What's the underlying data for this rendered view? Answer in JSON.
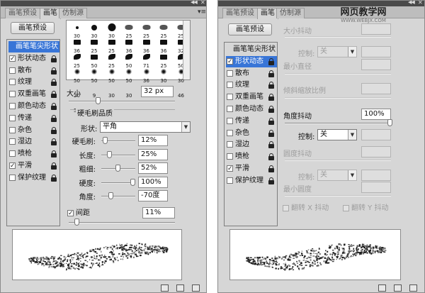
{
  "watermark": {
    "main": "网页教学网",
    "sub": "WWW.WEBJX.COM"
  },
  "left": {
    "tabs": [
      {
        "label": "画笔预设",
        "active": false
      },
      {
        "label": "画笔",
        "active": true
      },
      {
        "label": "仿制源",
        "active": false
      }
    ],
    "preset_button": "画笔预设",
    "options": [
      {
        "label": "画笔笔尖形状",
        "header": true,
        "selected": true,
        "checked": false
      },
      {
        "label": "形状动态",
        "checked": true,
        "lock": true
      },
      {
        "label": "散布",
        "checked": false,
        "lock": true
      },
      {
        "label": "纹理",
        "checked": false,
        "lock": true
      },
      {
        "label": "双重画笔",
        "checked": false,
        "lock": true
      },
      {
        "label": "颜色动态",
        "checked": false,
        "lock": true
      },
      {
        "label": "传递",
        "checked": false,
        "lock": true
      },
      {
        "label": "杂色",
        "checked": false,
        "lock": true
      },
      {
        "label": "湿边",
        "checked": false,
        "lock": true
      },
      {
        "label": "喷枪",
        "checked": false,
        "lock": true
      },
      {
        "label": "平滑",
        "checked": true,
        "lock": true
      },
      {
        "label": "保护纹理",
        "checked": false,
        "lock": true
      }
    ],
    "brush_sizes": [
      "30",
      "30",
      "30",
      "25",
      "25",
      "25",
      "25",
      "36",
      "25",
      "25",
      "36",
      "36",
      "36",
      "32",
      "25",
      "50",
      "25",
      "50",
      "71",
      "25",
      "50",
      "50",
      "50",
      "50",
      "50",
      "36",
      "30",
      "30",
      "20",
      "9",
      "30",
      "30",
      "27",
      "39",
      "46",
      "59"
    ],
    "size": {
      "label": "大小",
      "value": "32 px",
      "level": 0.05
    },
    "bristle": {
      "title": "硬毛刷品质",
      "shape_label": "形状:",
      "shape_value": "平角",
      "rows": [
        {
          "label": "硬毛刷:",
          "value": "12%",
          "level": 0.12
        },
        {
          "label": "长度:",
          "value": "25%",
          "level": 0.25
        },
        {
          "label": "粗细:",
          "value": "52%",
          "level": 0.52
        },
        {
          "label": "硬度:",
          "value": "100%",
          "level": 1.0
        },
        {
          "label": "角度:",
          "value": "-70度",
          "level": 0.3
        }
      ]
    },
    "spacing": {
      "label": "间距",
      "checked": true,
      "value": "11%",
      "level": 0.05
    }
  },
  "right": {
    "tabs": [
      {
        "label": "画笔预设",
        "active": false
      },
      {
        "label": "画笔",
        "active": true
      },
      {
        "label": "仿制源",
        "active": false
      }
    ],
    "preset_button": "画笔预设",
    "options": [
      {
        "label": "画笔笔尖形状",
        "header": true,
        "selected": false,
        "checked": false
      },
      {
        "label": "形状动态",
        "checked": true,
        "lock": true,
        "selected": true
      },
      {
        "label": "散布",
        "checked": false,
        "lock": true
      },
      {
        "label": "纹理",
        "checked": false,
        "lock": true
      },
      {
        "label": "双重画笔",
        "checked": false,
        "lock": true
      },
      {
        "label": "颜色动态",
        "checked": false,
        "lock": true
      },
      {
        "label": "传递",
        "checked": false,
        "lock": true
      },
      {
        "label": "杂色",
        "checked": false,
        "lock": true
      },
      {
        "label": "湿边",
        "checked": false,
        "lock": true
      },
      {
        "label": "喷枪",
        "checked": false,
        "lock": true
      },
      {
        "label": "平滑",
        "checked": true,
        "lock": true
      },
      {
        "label": "保护纹理",
        "checked": false,
        "lock": true
      }
    ],
    "size_jitter_label": "大小抖动",
    "control_label": "控制:",
    "control_off": "关",
    "min_diameter_label": "最小直径",
    "tilt_scale_label": "倾斜缩放比例",
    "angle_jitter": {
      "label": "角度抖动",
      "value": "100%",
      "level": 1.0
    },
    "roundness_jitter_label": "圆度抖动",
    "min_roundness_label": "最小圆度",
    "flip_x_label": "翻转 X 抖动",
    "flip_y_label": "翻转 Y 抖动"
  }
}
